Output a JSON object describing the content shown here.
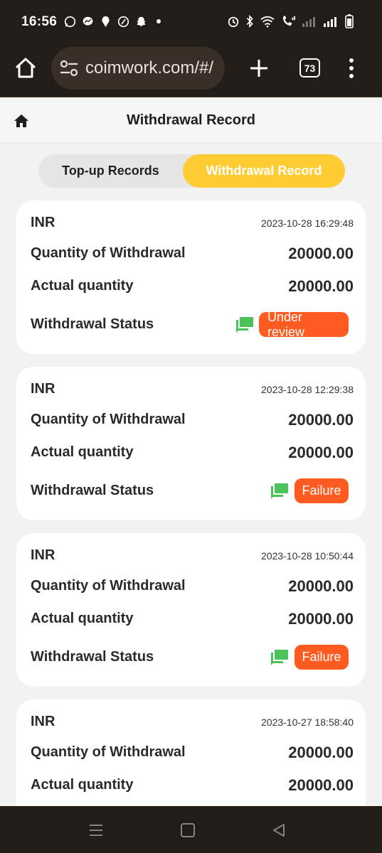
{
  "status_bar": {
    "time": "16:56"
  },
  "browser": {
    "url": "coimwork.com/#/",
    "tab_count": "73"
  },
  "page": {
    "title": "Withdrawal Record"
  },
  "tabs": [
    {
      "label": "Top-up Records",
      "active": false
    },
    {
      "label": "Withdrawal Record",
      "active": true
    }
  ],
  "labels": {
    "quantity": "Quantity of Withdrawal",
    "actual": "Actual quantity",
    "status": "Withdrawal Status"
  },
  "records": [
    {
      "currency": "INR",
      "datetime": "2023-10-28 16:29:48",
      "quantity": "20000.00",
      "actual": "20000.00",
      "status": "Under review"
    },
    {
      "currency": "INR",
      "datetime": "2023-10-28 12:29:38",
      "quantity": "20000.00",
      "actual": "20000.00",
      "status": "Failure"
    },
    {
      "currency": "INR",
      "datetime": "2023-10-28 10:50:44",
      "quantity": "20000.00",
      "actual": "20000.00",
      "status": "Failure"
    },
    {
      "currency": "INR",
      "datetime": "2023-10-27 18:58:40",
      "quantity": "20000.00",
      "actual": "20000.00"
    }
  ],
  "colors": {
    "accent": "#ffcc33",
    "status_badge": "#ff5a1f",
    "chat_icon": "#4cc35a",
    "chrome_bg": "#221d19"
  },
  "icons": [
    "whatsapp-icon",
    "messenger-icon",
    "notification-icon",
    "signal-icon",
    "snapchat-icon",
    "alarm-icon",
    "bluetooth-icon",
    "wifi-icon",
    "wifi-calling-icon",
    "cell-signal-icon",
    "battery-icon",
    "home-icon",
    "site-settings-icon",
    "new-tab-icon",
    "more-icon",
    "chat-icon"
  ]
}
